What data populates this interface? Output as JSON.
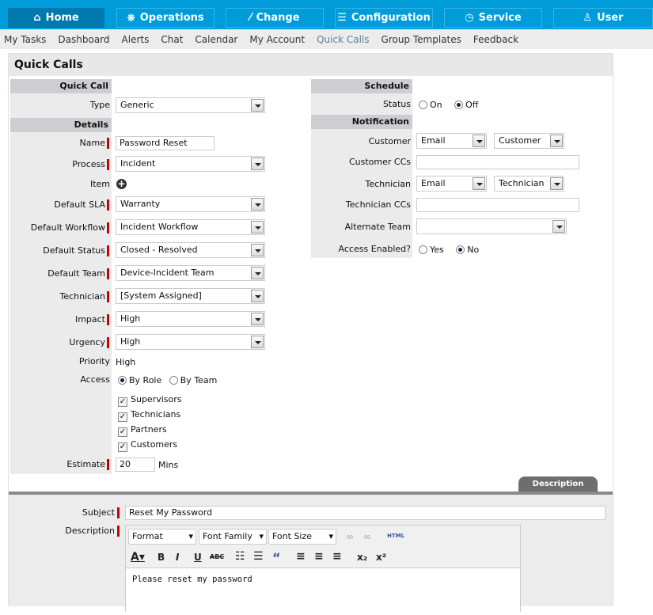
{
  "topnav": [
    {
      "label": "Home",
      "icon": "home-icon"
    },
    {
      "label": "Operations",
      "icon": "wheel-icon"
    },
    {
      "label": "Change",
      "icon": "change-icon"
    },
    {
      "label": "Configuration",
      "icon": "sliders-icon"
    },
    {
      "label": "Service",
      "icon": "clock-icon"
    },
    {
      "label": "User",
      "icon": "user-icon"
    }
  ],
  "subnav": [
    "My Tasks",
    "Dashboard",
    "Alerts",
    "Chat",
    "Calendar",
    "My Account",
    "Quick Calls",
    "Group Templates",
    "Feedback"
  ],
  "page_title": "Quick Calls",
  "left": {
    "quick_call_header": "Quick Call",
    "type_label": "Type",
    "type_value": "Generic",
    "details_header": "Details",
    "name_label": "Name",
    "name_value": "Password Reset",
    "process_label": "Process",
    "process_value": "Incident",
    "item_label": "Item",
    "sla_label": "Default SLA",
    "sla_value": "Warranty",
    "workflow_label": "Default Workflow",
    "workflow_value": "Incident Workflow",
    "status_label": "Default Status",
    "status_value": "Closed - Resolved",
    "team_label": "Default Team",
    "team_value": "Device-Incident Team",
    "technician_label": "Technician",
    "technician_value": "[System Assigned]",
    "impact_label": "Impact",
    "impact_value": "High",
    "urgency_label": "Urgency",
    "urgency_value": "High",
    "priority_label": "Priority",
    "priority_value": "High",
    "access_label": "Access",
    "by_role": "By Role",
    "by_team": "By Team",
    "checks": [
      "Supervisors",
      "Technicians",
      "Partners",
      "Customers"
    ],
    "estimate_label": "Estimate",
    "estimate_value": "20",
    "mins": "Mins"
  },
  "right": {
    "schedule_header": "Schedule",
    "status_label": "Status",
    "on": "On",
    "off": "Off",
    "notification_header": "Notification",
    "customer_label": "Customer",
    "customer_method": "Email",
    "customer_recipient": "Customer",
    "customer_ccs_label": "Customer CCs",
    "technician_label": "Technician",
    "technician_method": "Email",
    "technician_recipient": "Technician",
    "technician_ccs_label": "Technician CCs",
    "alt_team_label": "Alternate Team",
    "access_enabled_label": "Access Enabled?",
    "yes": "Yes",
    "no": "No"
  },
  "description": {
    "tab": "Description",
    "subject_label": "Subject",
    "subject_value": "Reset My Password",
    "description_label": "Description",
    "format": "Format",
    "font_family": "Font Family",
    "font_size": "Font Size",
    "html": "HTML",
    "body": "Please reset my password"
  }
}
